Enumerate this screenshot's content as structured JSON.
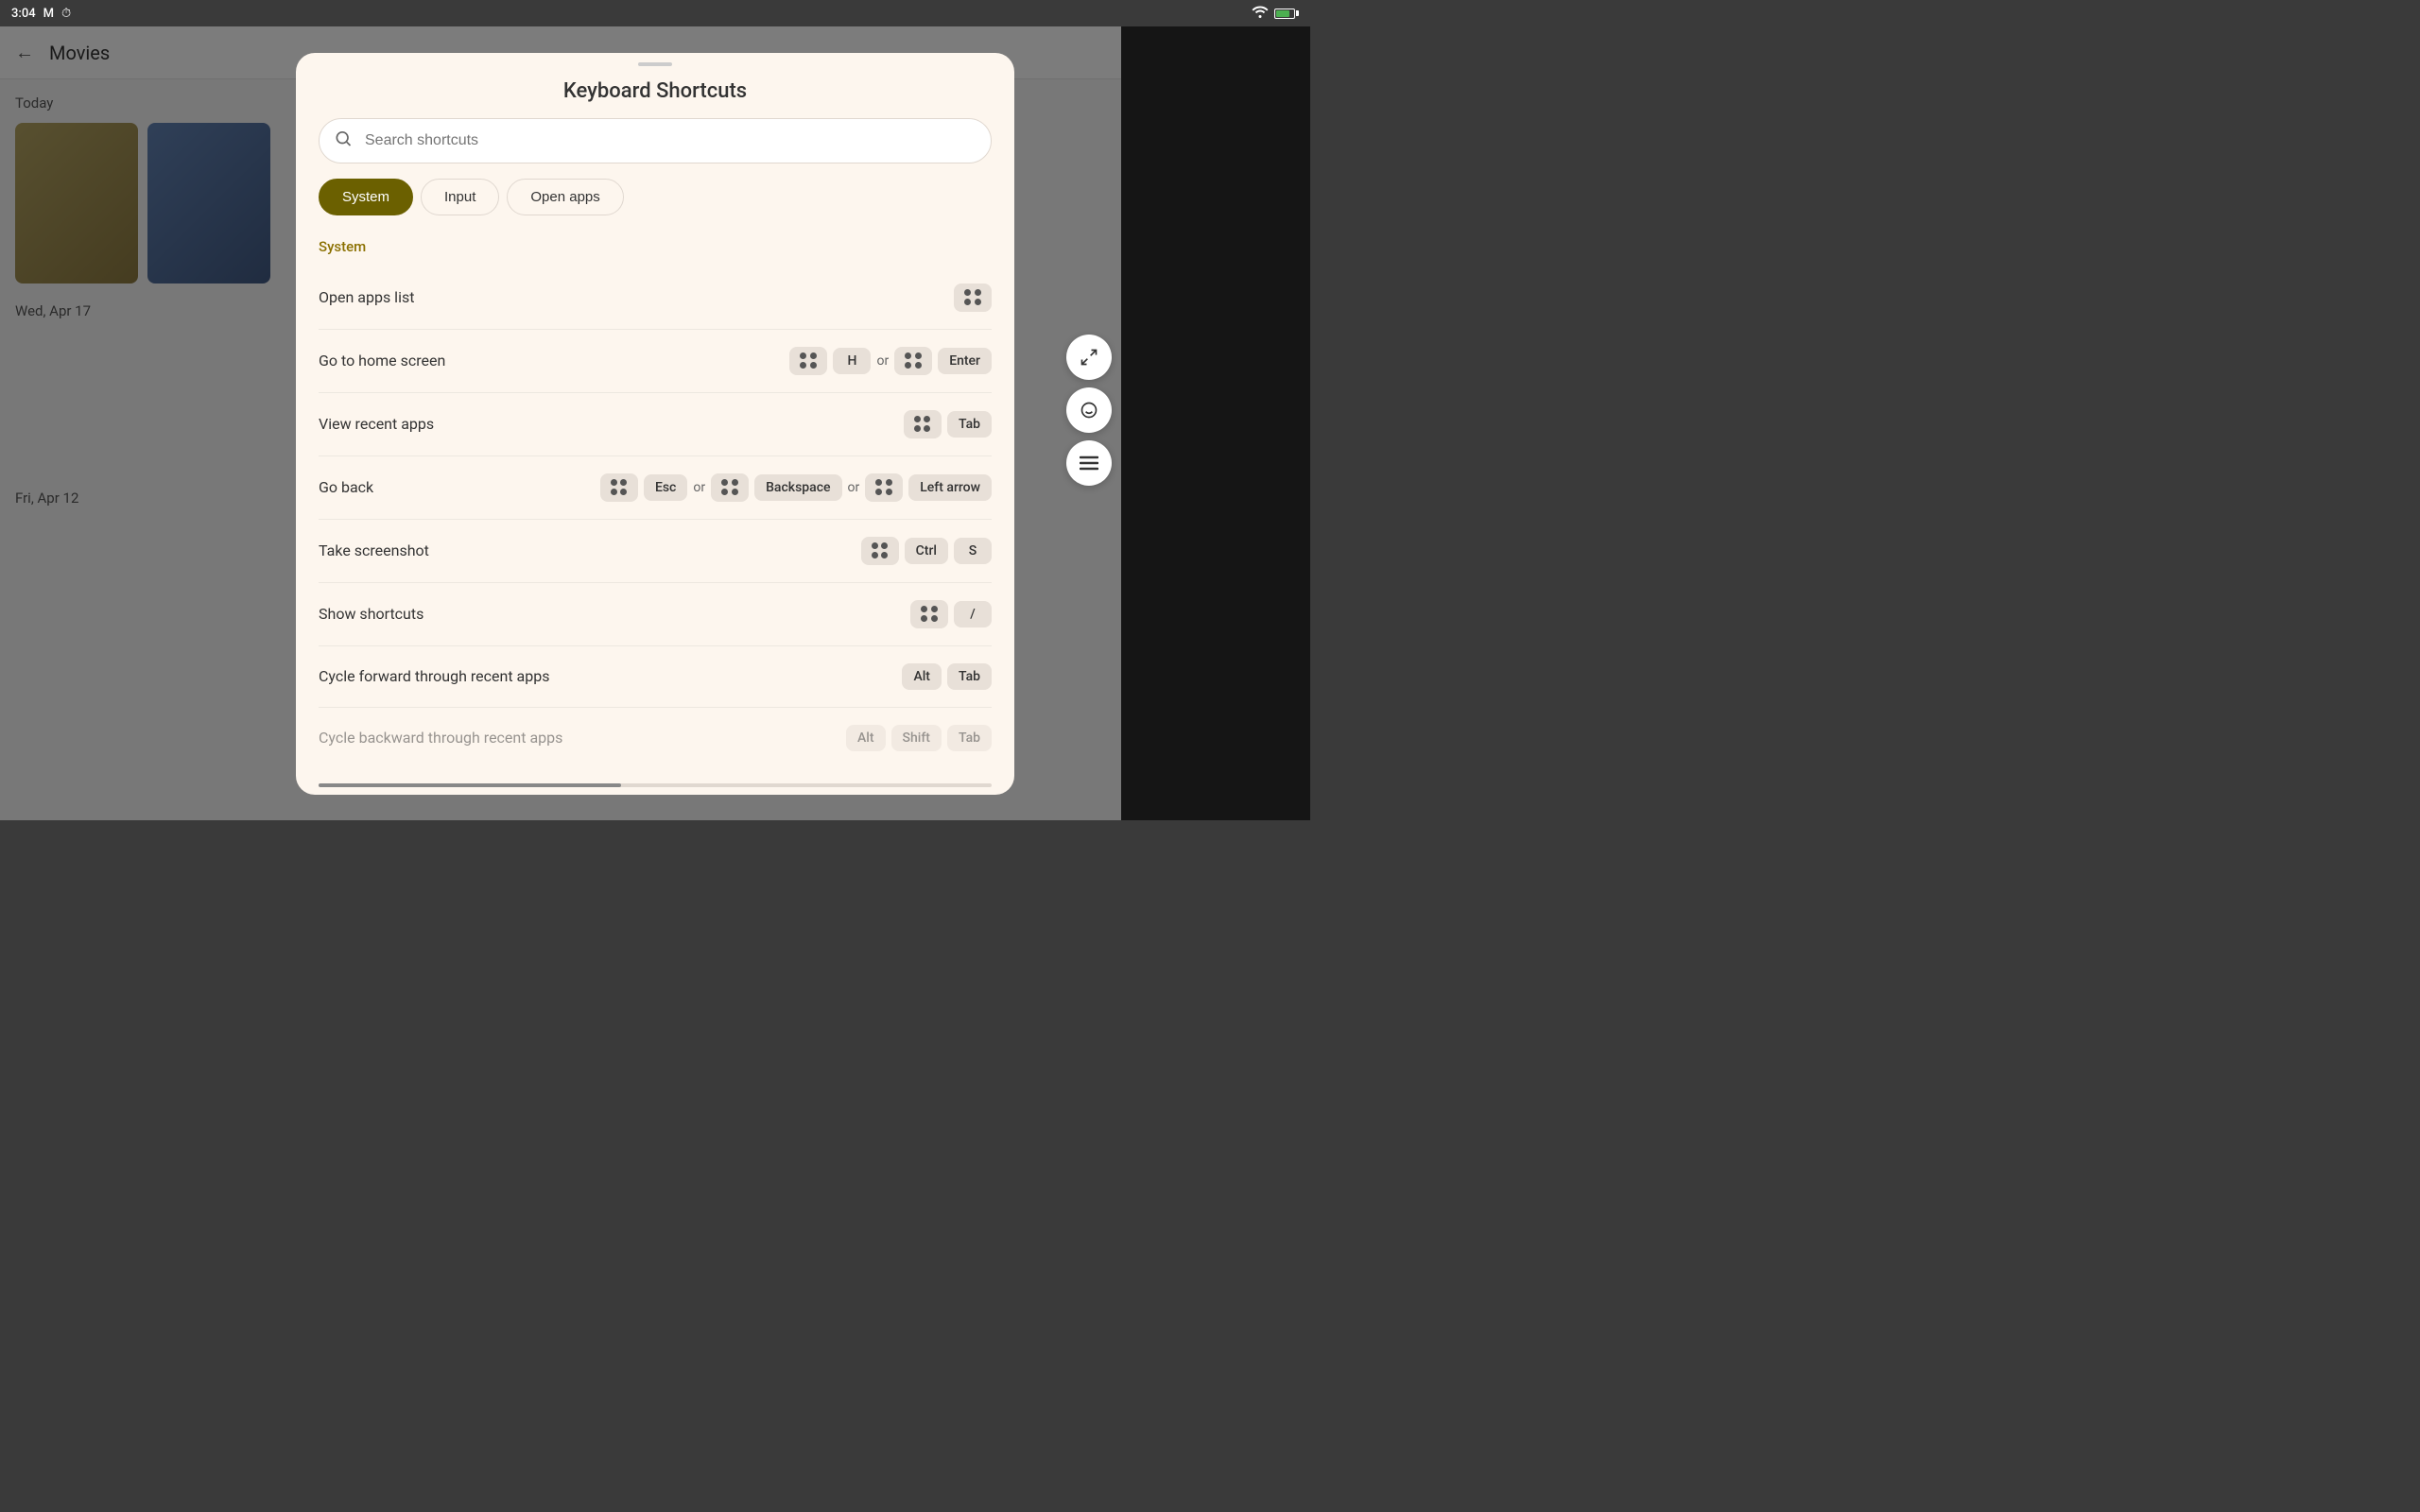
{
  "statusBar": {
    "time": "3:04",
    "icons": [
      "gmail-icon",
      "alarm-icon",
      "wifi-icon",
      "battery-icon"
    ]
  },
  "bgApp": {
    "backLabel": "←",
    "title": "Movies",
    "sections": [
      {
        "label": "Today"
      },
      {
        "label": "Wed, Apr 17"
      },
      {
        "label": "Fri, Apr 12"
      }
    ]
  },
  "modal": {
    "dragHandle": true,
    "title": "Keyboard Shortcuts",
    "search": {
      "placeholder": "Search shortcuts"
    },
    "tabs": [
      {
        "id": "system",
        "label": "System",
        "active": true
      },
      {
        "id": "input",
        "label": "Input",
        "active": false
      },
      {
        "id": "open-apps",
        "label": "Open apps",
        "active": false
      }
    ],
    "sectionLabel": "System",
    "shortcuts": [
      {
        "id": "open-apps-list",
        "label": "Open apps list",
        "keys": [
          {
            "type": "dots"
          }
        ]
      },
      {
        "id": "go-to-home",
        "label": "Go to home screen",
        "keys": [
          {
            "type": "dots"
          },
          {
            "type": "text",
            "value": "H"
          },
          {
            "type": "or"
          },
          {
            "type": "dots"
          },
          {
            "type": "text",
            "value": "Enter"
          }
        ]
      },
      {
        "id": "view-recent",
        "label": "View recent apps",
        "keys": [
          {
            "type": "dots"
          },
          {
            "type": "text",
            "value": "Tab"
          }
        ]
      },
      {
        "id": "go-back",
        "label": "Go back",
        "keys": [
          {
            "type": "dots"
          },
          {
            "type": "text",
            "value": "Esc"
          },
          {
            "type": "or"
          },
          {
            "type": "dots"
          },
          {
            "type": "text",
            "value": "Backspace"
          },
          {
            "type": "or"
          },
          {
            "type": "dots"
          },
          {
            "type": "text",
            "value": "Left arrow"
          }
        ]
      },
      {
        "id": "take-screenshot",
        "label": "Take screenshot",
        "keys": [
          {
            "type": "dots"
          },
          {
            "type": "text",
            "value": "Ctrl"
          },
          {
            "type": "text",
            "value": "S"
          }
        ]
      },
      {
        "id": "show-shortcuts",
        "label": "Show shortcuts",
        "keys": [
          {
            "type": "dots"
          },
          {
            "type": "text",
            "value": "/"
          }
        ]
      },
      {
        "id": "cycle-forward",
        "label": "Cycle forward through recent apps",
        "keys": [
          {
            "type": "text",
            "value": "Alt"
          },
          {
            "type": "text",
            "value": "Tab"
          }
        ]
      },
      {
        "id": "cycle-backward",
        "label": "Cycle backward through recent apps",
        "keys": [
          {
            "type": "text",
            "value": "Alt"
          },
          {
            "type": "text",
            "value": "Shift"
          },
          {
            "type": "text",
            "value": "Tab"
          }
        ]
      }
    ]
  },
  "fabs": [
    {
      "id": "expand-icon",
      "symbol": "↗"
    },
    {
      "id": "emoji-icon",
      "symbol": "☺"
    },
    {
      "id": "menu-icon",
      "symbol": "≡"
    }
  ]
}
